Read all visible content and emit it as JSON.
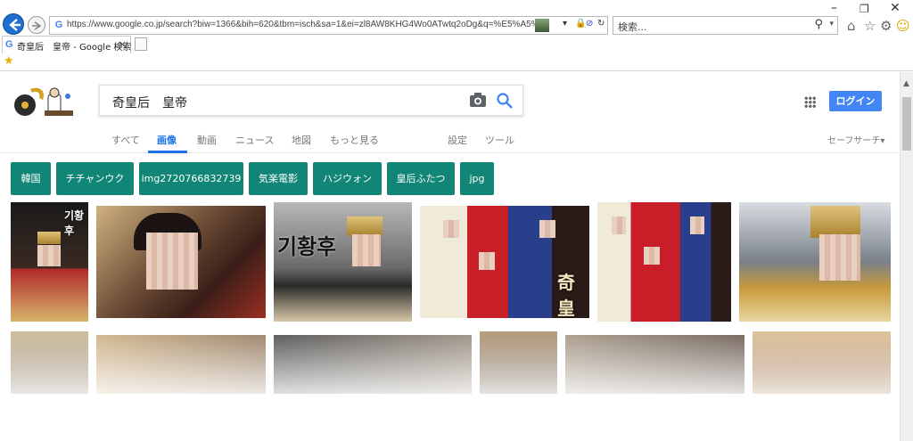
{
  "browser": {
    "url": "https://www.google.co.jp/search?biw=1366&bih=620&tbm=isch&sa=1&ei=zl8AW8KHG4Wo0ATwtq2oDg&q=%E5%A5%87%E7%9A%",
    "search_placeholder": "検索...",
    "tab_title": "奇皇后　皇帝 - Google 検索",
    "tab_close": "×",
    "favicon": "G"
  },
  "google": {
    "query": "奇皇后　皇帝",
    "login_label": "ログイン",
    "tabs": [
      "すべて",
      "画像",
      "動画",
      "ニュース",
      "地図",
      "もっと見る",
      "設定",
      "ツール"
    ],
    "active_tab": "画像",
    "safe_search": "セーフサーチ▾",
    "chips": [
      "韓国",
      "チチャンウク",
      "img2720766832739",
      "気楽電影",
      "ハジウォン",
      "皇后ふたつ",
      "jpg"
    ]
  },
  "images": {
    "watermark_1": "기황후",
    "watermark_2": "奇皇"
  },
  "colors": {
    "accent": "#1a73e8",
    "login": "#4285f4",
    "chip": "#118576"
  }
}
